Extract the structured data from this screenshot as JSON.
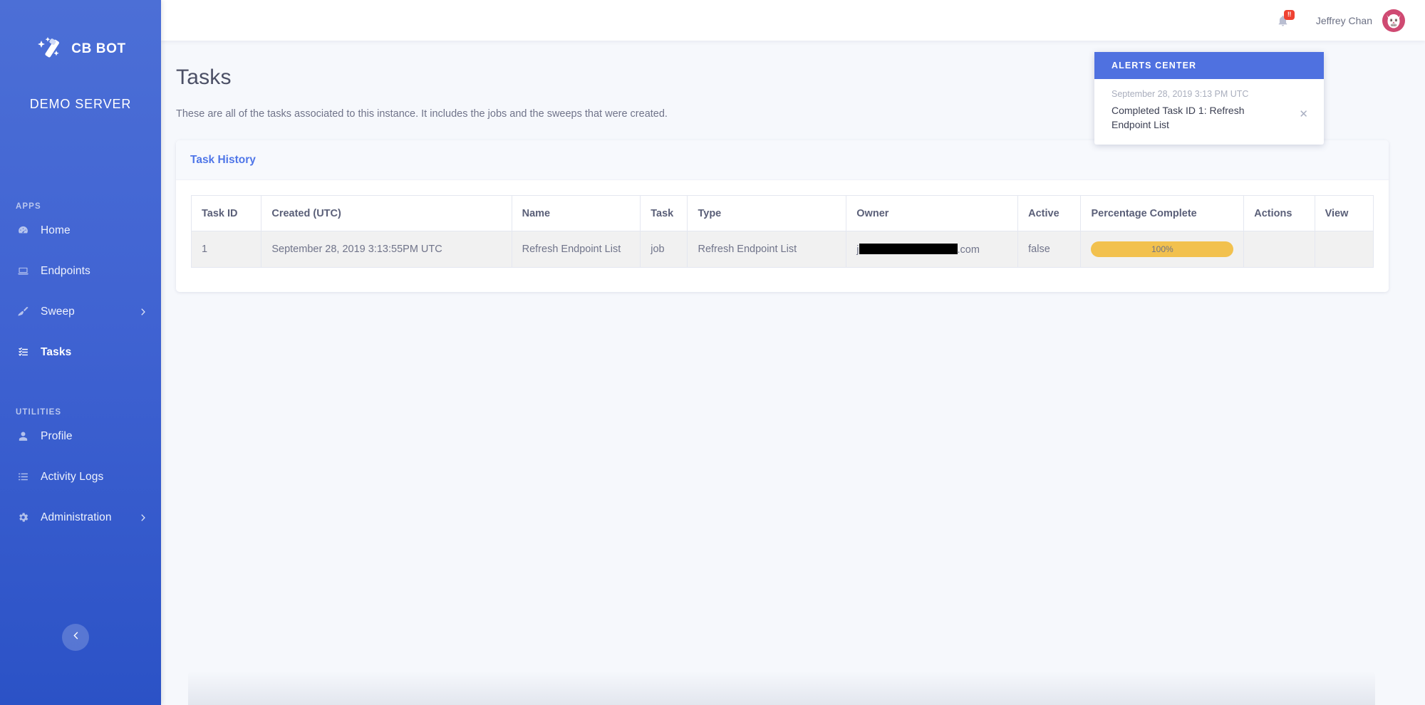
{
  "sidebar": {
    "brand": "CB BOT",
    "brand_icon": "magic-wand-icon",
    "server": "DEMO SERVER",
    "sections": [
      {
        "title": "APPS",
        "items": [
          {
            "label": "Home",
            "icon": "dashboard-icon",
            "active": false,
            "chevron": false
          },
          {
            "label": "Endpoints",
            "icon": "laptop-icon",
            "active": false,
            "chevron": false
          },
          {
            "label": "Sweep",
            "icon": "broom-icon",
            "active": false,
            "chevron": true
          },
          {
            "label": "Tasks",
            "icon": "checklist-icon",
            "active": true,
            "chevron": false
          }
        ]
      },
      {
        "title": "UTILITIES",
        "items": [
          {
            "label": "Profile",
            "icon": "user-icon",
            "active": false,
            "chevron": false
          },
          {
            "label": "Activity Logs",
            "icon": "list-icon",
            "active": false,
            "chevron": false
          },
          {
            "label": "Administration",
            "icon": "gear-icon",
            "active": false,
            "chevron": true
          }
        ]
      }
    ],
    "collapse_icon": "chevron-left-icon",
    "bg_color": "#4063d2"
  },
  "topbar": {
    "bell_icon": "bell-icon",
    "bell_badge": "!!",
    "bell_badge_color": "#ef4232",
    "user_name": "Jeffrey Chan",
    "avatar_icon": "owl-avatar",
    "avatar_color": "#cf4a72"
  },
  "page": {
    "title": "Tasks",
    "description": "These are all of the tasks associated to this instance. It includes the jobs and the sweeps that were created."
  },
  "card": {
    "title": "Task History",
    "title_color": "#4f76e8"
  },
  "table": {
    "columns": [
      "Task ID",
      "Created (UTC)",
      "Name",
      "Task",
      "Type",
      "Owner",
      "Active",
      "Percentage Complete",
      "Actions",
      "View"
    ],
    "rows": [
      {
        "task_id": "1",
        "created": "September 28, 2019 3:13:55PM UTC",
        "name": "Refresh Endpoint List",
        "task": "job",
        "type": "Refresh Endpoint List",
        "owner_prefix": "j",
        "owner_suffix": ".com",
        "owner_redacted": true,
        "active": "false",
        "percentage": "100%",
        "percentage_value": 100,
        "percentage_color": "#f2c14e",
        "actions": "",
        "view": ""
      }
    ]
  },
  "alerts": {
    "header": "ALERTS CENTER",
    "header_color": "#4f71e0",
    "items": [
      {
        "time": "September 28, 2019 3:13 PM UTC",
        "message": "Completed Task ID 1: Refresh Endpoint List",
        "close_icon": "close-icon"
      }
    ]
  }
}
